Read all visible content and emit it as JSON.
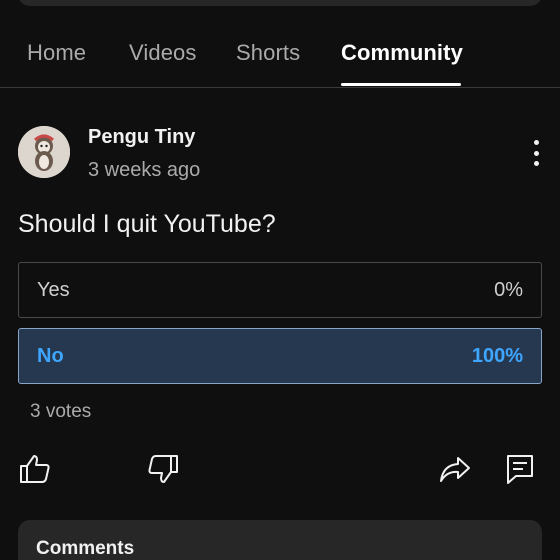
{
  "tabs": [
    {
      "label": "Home"
    },
    {
      "label": "Videos"
    },
    {
      "label": "Shorts"
    },
    {
      "label": "Community",
      "active": true
    }
  ],
  "post": {
    "author": "Pengu Tiny",
    "time": "3 weeks ago",
    "question": "Should I quit YouTube?",
    "options": [
      {
        "label": "Yes",
        "percent": "0%"
      },
      {
        "label": "No",
        "percent": "100%",
        "selected": true
      }
    ],
    "votes": "3 votes"
  },
  "icons": {
    "like": "thumbs-up-icon",
    "dislike": "thumbs-down-icon",
    "share": "share-icon",
    "comment": "comment-icon",
    "more": "more-vertical-icon"
  },
  "comments": {
    "title": "Comments"
  },
  "colors": {
    "background": "#0f0f0f",
    "selected_fill": "#263850",
    "selected_text": "#3ea6ff"
  }
}
